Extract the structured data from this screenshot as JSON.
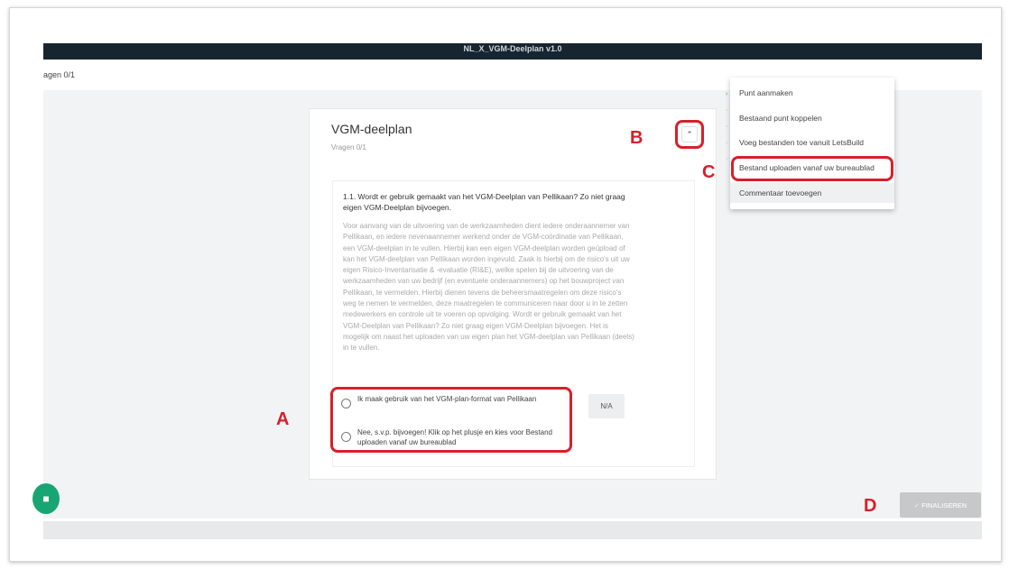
{
  "window": {
    "title": "NL_X_VGM-Deelplan v1.0"
  },
  "header": {
    "left_counter": "agen 0/1"
  },
  "card": {
    "title": "VGM-deelplan",
    "subtitle": "Vragen 0/1"
  },
  "question": {
    "title": "1.1. Wordt er gebruik gemaakt van het VGM-Deelplan van Pellikaan? Zo niet graag eigen VGM-Deelplan bijvoegen.",
    "description": "Voor aanvang van de uitvoering van de werkzaamheden dient iedere onderaannemer van Pellikaan, en iedere nevenaannemer werkend onder de VGM-coördinatie van Pellikaan, een VGM-deelplan in te vullen. Hierbij kan een eigen VGM-deelplan worden geüpload of kan het VGM-deelplan van Pellikaan worden ingevuld. Zaak is hierbij om de risico's uit uw eigen Risico-Inventarisatie & -evaluatie (RI&E), welke spelen bij de uitvoering van de werkzaamheden van uw bedrijf (en eventuele onderaannemers) op het bouwproject van Pellikaan, te vermelden. Hierbij dienen tevens de beheersmaatregelen om deze risico's weg te nemen te vermelden, deze maatregelen te communiceren naar door u in te zetten medewerkers en controle uit te voeren op opvolging. Wordt er gebruik gemaakt van het VGM-Deelplan van Pellikaan? Zo niet graag eigen VGM-Deelplan bijvoegen. Het is mogelijk om naast het uploaden van uw eigen plan het VGM-deelplan van Pellikaan (deels) in te vullen.",
    "options": [
      "Ik maak gebruik van het VGM-plan-format van Pellikaan",
      "Nee, s.v.p. bijvoegen! Klik op het plusje en kies voor Bestand uploaden vanaf uw bureaublad"
    ],
    "na_label": "N/A"
  },
  "menu": {
    "items": [
      "Punt aanmaken",
      "Bestaand punt koppelen",
      "Voeg bestanden toe vanuit LetsBuild",
      "Bestand uploaden vanaf uw bureaublad",
      "Commentaar toevoegen"
    ]
  },
  "annotations": {
    "a": "A",
    "b": "B",
    "c": "C",
    "d": "D"
  },
  "finalize": {
    "label": "✓ FINALISEREN"
  },
  "icons": {
    "collapse": "chevron-up-icon",
    "chat": "chat-icon",
    "radio": "radio-icon"
  },
  "colors": {
    "annotation_red": "#d6202b",
    "topbar": "#162530",
    "chat": "#17a673"
  }
}
